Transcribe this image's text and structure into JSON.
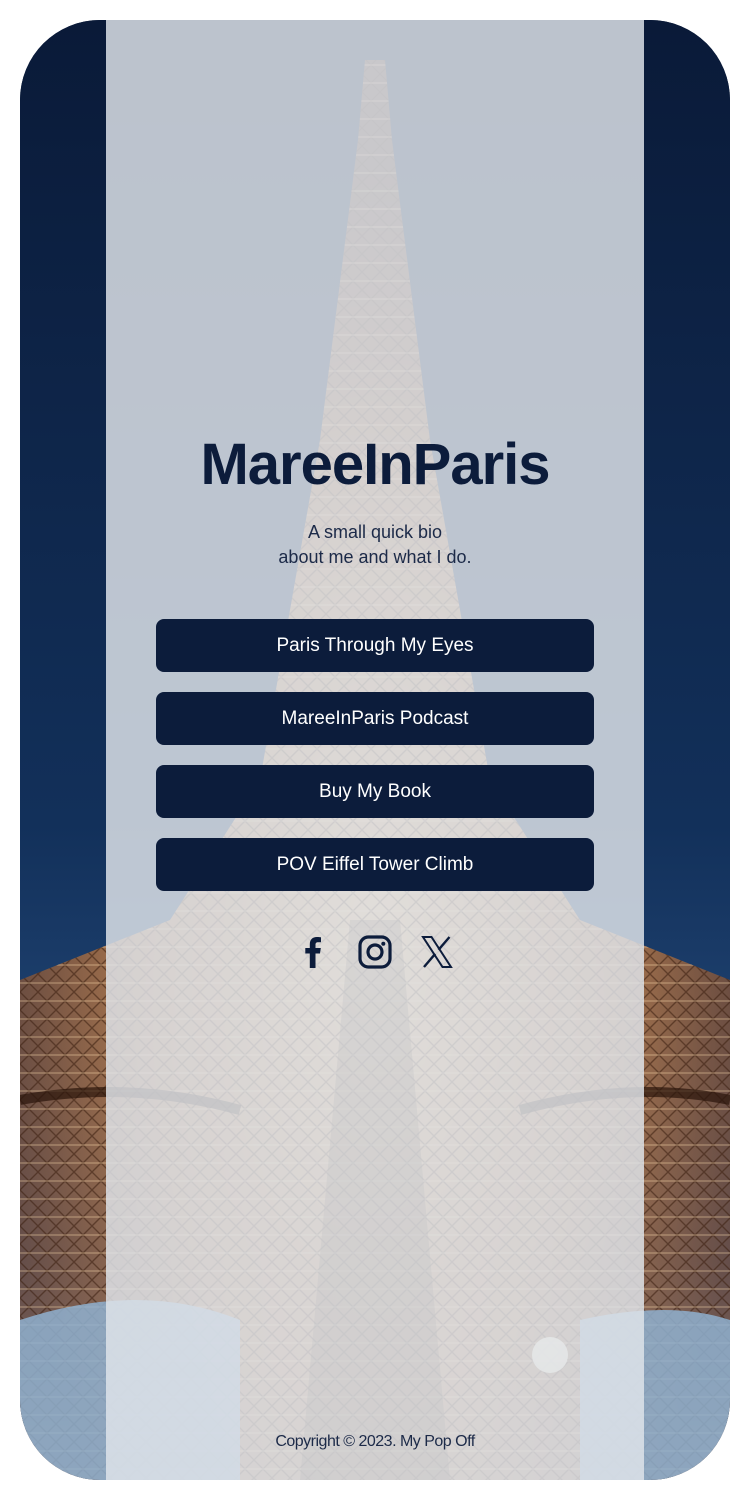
{
  "profile": {
    "name": "MareeInParis",
    "bio_line1": "A small quick bio",
    "bio_line2": "about me and what I do."
  },
  "links": [
    {
      "label": "Paris Through My Eyes"
    },
    {
      "label": "MareeInParis Podcast"
    },
    {
      "label": "Buy My Book"
    },
    {
      "label": "POV Eiffel Tower Climb"
    }
  ],
  "social": [
    {
      "icon": "facebook-icon"
    },
    {
      "icon": "instagram-icon"
    },
    {
      "icon": "x-icon"
    }
  ],
  "footer": {
    "copyright": "Copyright © 2023. My Pop Off"
  },
  "colors": {
    "primary": "#0c1c3b",
    "panel": "#dfe3ea",
    "button_text": "#ffffff",
    "tower_light": "#f3b774"
  }
}
